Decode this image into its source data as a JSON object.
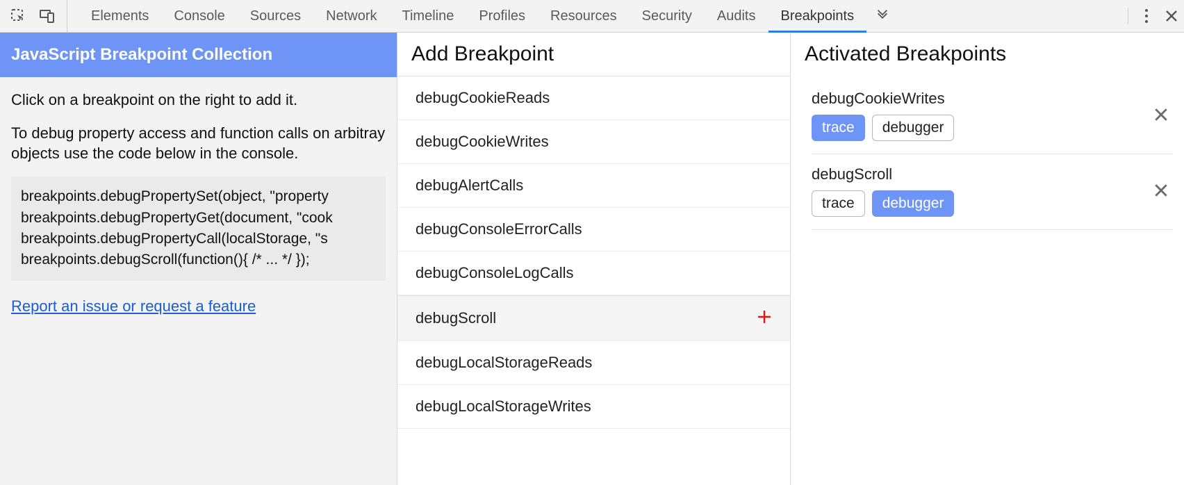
{
  "toolbar": {
    "tabs": [
      "Elements",
      "Console",
      "Sources",
      "Network",
      "Timeline",
      "Profiles",
      "Resources",
      "Security",
      "Audits",
      "Breakpoints"
    ],
    "active_tab_index": 9
  },
  "left": {
    "header": "JavaScript Breakpoint Collection",
    "intro1": "Click on a breakpoint on the right to add it.",
    "intro2": "To debug property access and function calls on arbitray objects use the code below in the console.",
    "code_lines": [
      "breakpoints.debugPropertySet(object, \"property",
      "breakpoints.debugPropertyGet(document, \"cook",
      "breakpoints.debugPropertyCall(localStorage, \"s",
      "breakpoints.debugScroll(function(){ /* ... */ });"
    ],
    "report_link": "Report an issue or request a feature"
  },
  "middle": {
    "title": "Add Breakpoint",
    "items": [
      {
        "name": "debugCookieReads",
        "hover": false
      },
      {
        "name": "debugCookieWrites",
        "hover": false
      },
      {
        "name": "debugAlertCalls",
        "hover": false
      },
      {
        "name": "debugConsoleErrorCalls",
        "hover": false
      },
      {
        "name": "debugConsoleLogCalls",
        "hover": false
      },
      {
        "name": "debugScroll",
        "hover": true
      },
      {
        "name": "debugLocalStorageReads",
        "hover": false
      },
      {
        "name": "debugLocalStorageWrites",
        "hover": false
      }
    ]
  },
  "right": {
    "title": "Activated Breakpoints",
    "items": [
      {
        "name": "debugCookieWrites",
        "options": [
          {
            "label": "trace",
            "selected": true
          },
          {
            "label": "debugger",
            "selected": false
          }
        ]
      },
      {
        "name": "debugScroll",
        "options": [
          {
            "label": "trace",
            "selected": false
          },
          {
            "label": "debugger",
            "selected": true
          }
        ]
      }
    ]
  }
}
